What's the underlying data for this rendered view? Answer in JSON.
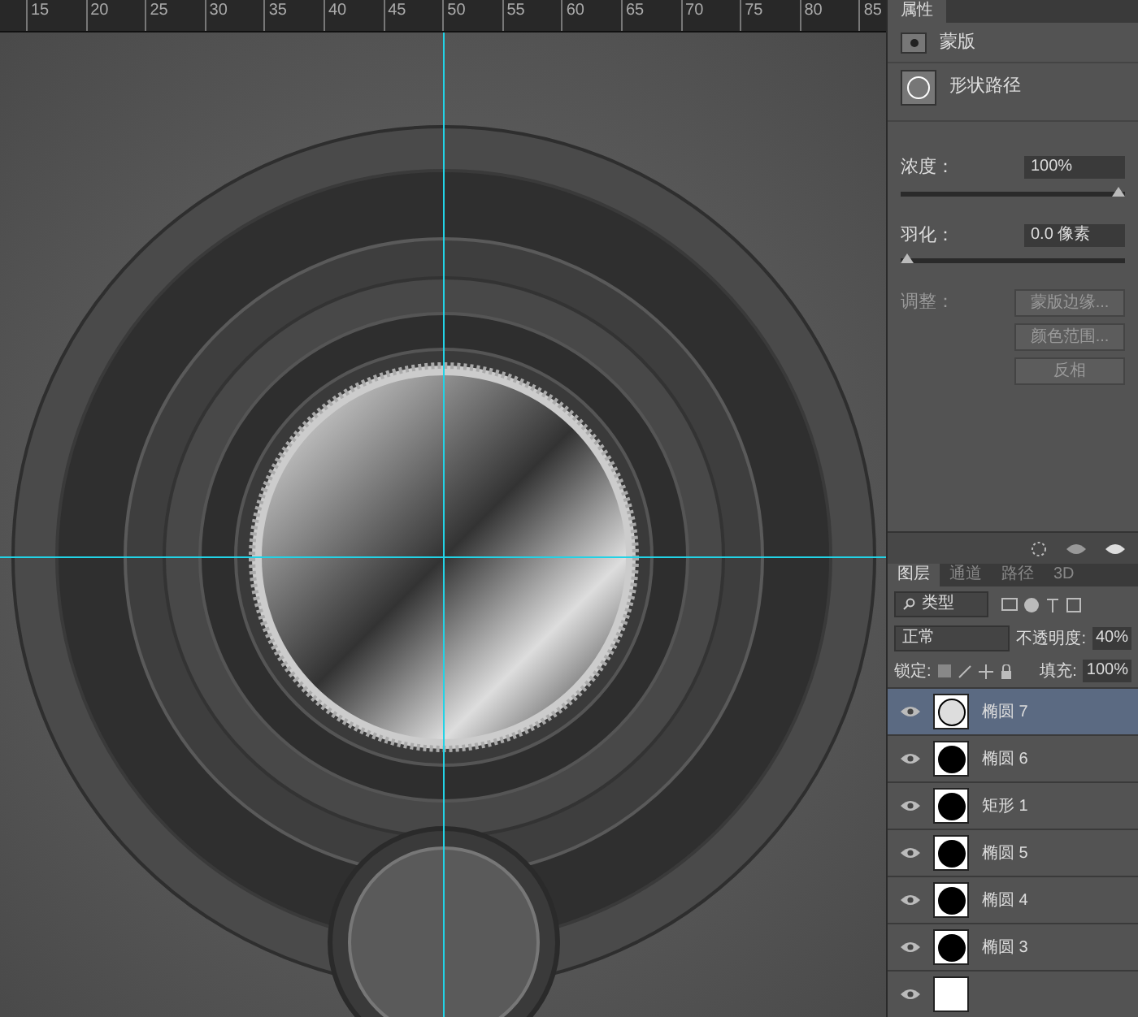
{
  "ruler": {
    "ticks": [
      "15",
      "20",
      "25",
      "30",
      "35",
      "40",
      "45",
      "50",
      "55",
      "60",
      "65",
      "70",
      "75",
      "80",
      "85"
    ]
  },
  "properties": {
    "tab": "属性",
    "mask_label": "蒙版",
    "shape_label": "形状路径",
    "density": {
      "label": "浓度：",
      "value": "100%",
      "level": 1
    },
    "feather": {
      "label": "羽化：",
      "value": "0.0 像素",
      "level": 0
    },
    "adjust_label": "调整：",
    "buttons": [
      "蒙版边缘...",
      "颜色范围...",
      "反相"
    ]
  },
  "layers_panel": {
    "tabs": [
      {
        "label": "图层",
        "selected": true
      },
      {
        "label": "通道",
        "selected": false
      },
      {
        "label": "路径",
        "selected": false
      },
      {
        "label": "3D",
        "selected": false
      }
    ],
    "filter": "类型",
    "blend_mode": "正常",
    "opacity_label": "不透明度:",
    "opacity": "40%",
    "lock_label": "锁定:",
    "fill_label": "填充:",
    "fill": "100%",
    "layers": [
      {
        "name": "椭圆 7",
        "selected": true,
        "visible": true
      },
      {
        "name": "椭圆 6",
        "selected": false,
        "visible": true
      },
      {
        "name": "矩形 1",
        "selected": false,
        "visible": true
      },
      {
        "name": "椭圆 5",
        "selected": false,
        "visible": true
      },
      {
        "name": "椭圆 4",
        "selected": false,
        "visible": true
      },
      {
        "name": "椭圆 3",
        "selected": false,
        "visible": true
      }
    ]
  }
}
